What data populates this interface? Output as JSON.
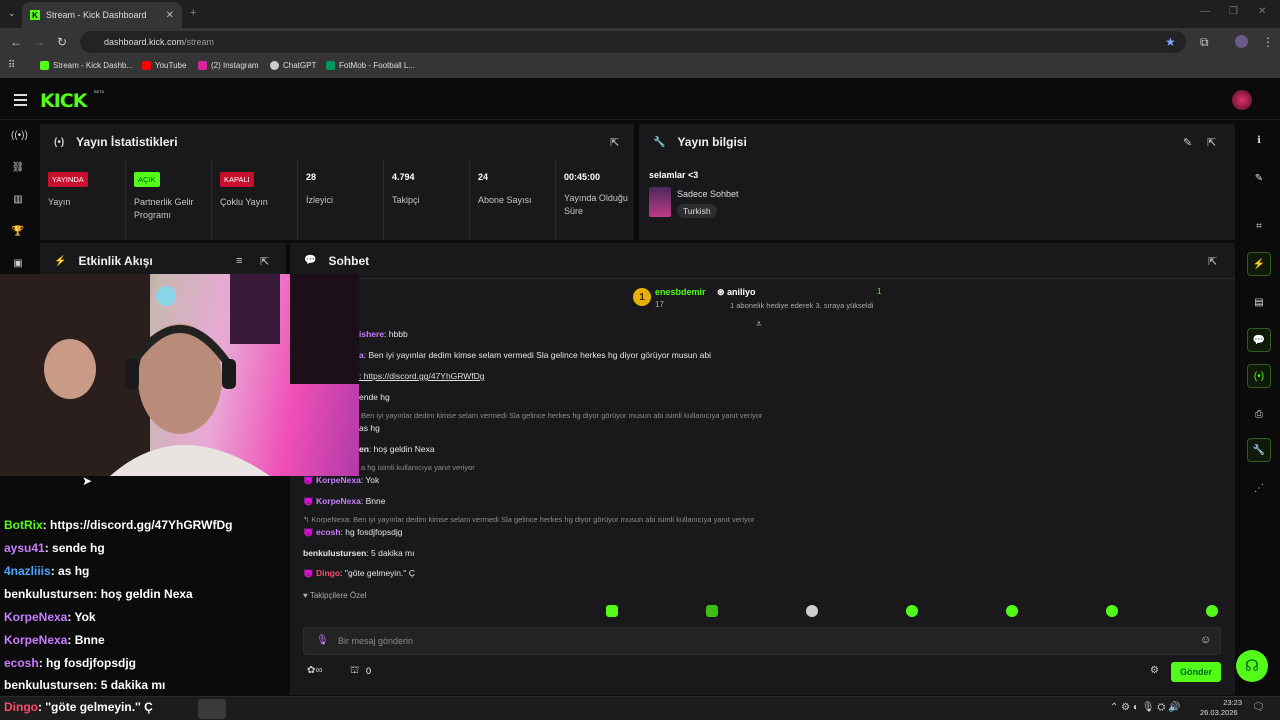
{
  "browser": {
    "tab_title": "Stream - Kick Dashboard",
    "url_host": "dashboard.kick.com",
    "url_path": "/stream",
    "bookmarks": [
      {
        "label": "Stream - Kick Dashb...",
        "color": "#53fc18"
      },
      {
        "label": "YouTube",
        "color": "#ff0000"
      },
      {
        "label": "(2) Instagram",
        "color": "#d6249f"
      },
      {
        "label": "ChatGPT",
        "color": "#cccccc"
      },
      {
        "label": "FotMob - Football L...",
        "color": "#00985f"
      }
    ]
  },
  "kick": {
    "logo": "KICK",
    "beta": "BETA",
    "accent": "#53fc18"
  },
  "stats_panel": {
    "title": "Yayın İstatistikleri",
    "cells": [
      {
        "badge": "YAYINDA",
        "label": "Yayın"
      },
      {
        "badge": "AÇIK",
        "label": "Partnerlik Gelir Programı"
      },
      {
        "badge": "KAPALI",
        "label": "Çoklu Yayın"
      },
      {
        "value": "28",
        "label": "İzleyici"
      },
      {
        "value": "4.794",
        "label": "Takipçi"
      },
      {
        "value": "24",
        "label": "Abone Sayısı"
      },
      {
        "value": "00:45:00",
        "label": "Yayında Olduğu Süre"
      }
    ]
  },
  "info_panel": {
    "title": "Yayın bilgisi",
    "stream_title": "selamlar <3",
    "category": "Sadece Sohbet",
    "language": "Turkish"
  },
  "activity_panel": {
    "title": "Etkinlik Akışı"
  },
  "chat_panel": {
    "title": "Sohbet",
    "pinned": {
      "rank": "1",
      "user": "enesbdemir",
      "user_sub": "17",
      "gifter": "aniliyo",
      "gifter_count": "1",
      "note": "1 abonelik hediye ederek 3. sıraya yükseldi"
    },
    "messages": [
      {
        "user": "ishere",
        "text": ": hbbb"
      },
      {
        "user": "a",
        "text": ": Ben iyi yayınlar dedim kimse selam vermedi Sla gelince herkes hg diyor görüyor musun abi"
      },
      {
        "user": "",
        "text": ": https://discord.gg/47YhGRWfDg"
      },
      {
        "reply": "Ben iyi yayınlar dedim kimse selam vermedi Sla gelince herkes hg diyor görüyor musun abi isimli kullanıcıya yanıt veriyor"
      },
      {
        "user": "",
        "text": "ende hg"
      },
      {
        "user": "",
        "text": "as hg"
      },
      {
        "user": "en",
        "text": ": hoş geldin Nexa"
      },
      {
        "reply": "a hg isimli kullanıcıya yanıt veriyor"
      },
      {
        "user": "KorpeNexa",
        "text": ": Yok"
      },
      {
        "user": "KorpeNexa",
        "text": ": Bnne"
      },
      {
        "reply": "KorpeNexa: Ben iyi yayınlar dedim kimse selam vermedi Sla gelince herkes hg diyor görüyor musun abi isimli kullanıcıya yanıt veriyor"
      },
      {
        "user": "ecosh",
        "text": ": hg fosdjfopsdjg"
      },
      {
        "user": "benkulustursen",
        "text": ": 5 dakika mı"
      },
      {
        "user": "Dingo",
        "text": ": ''göte gelmeyin.'' Ç"
      }
    ],
    "followers_only": "Takipçilere Özel",
    "input_placeholder": "Bir mesaj gönderin",
    "send_label": "Gönder",
    "points_label": "0"
  },
  "overlay_chat": [
    {
      "user": "BotRix",
      "text": ": https://discord.gg/47YhGRWfDg",
      "color": "#53fc18"
    },
    {
      "user": "aysu41",
      "text": ": sende hg",
      "color": "#c77dff"
    },
    {
      "user": "4nazliiis",
      "text": ": as hg",
      "color": "#4da3ff"
    },
    {
      "user": "benkulustursen",
      "text": ": hoş geldin Nexa",
      "color": "#ffffff"
    },
    {
      "user": "KorpeNexa",
      "text": ": Yok",
      "color": "#c77dff"
    },
    {
      "user": "KorpeNexa",
      "text": ": Bnne",
      "color": "#c77dff"
    },
    {
      "user": "ecosh",
      "text": ": hg fosdjfopsdjg",
      "color": "#c77dff"
    },
    {
      "user": "benkulustursen",
      "text": ": 5 dakika mı",
      "color": "#ffffff"
    },
    {
      "user": "Dingo",
      "text": ": ''göte gelmeyin.'' Ç",
      "color": "#ff4a6b"
    }
  ],
  "taskbar": {
    "time": "23:23",
    "date": "26.03.2026"
  }
}
